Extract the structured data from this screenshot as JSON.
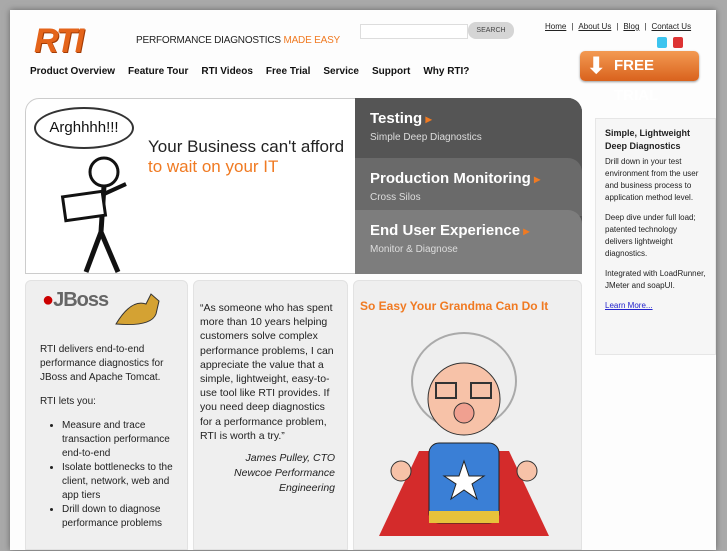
{
  "header": {
    "logo": "RTI",
    "tagline_main": "PERFORMANCE DIAGNOSTICS",
    "tagline_accent": "MADE EASY",
    "search_button": "SEARCH",
    "search_placeholder": "",
    "top_links": [
      "Home",
      "About Us",
      "Blog",
      "Contact Us"
    ],
    "free_trial_button": "FREE TRIAL"
  },
  "nav": [
    "Product Overview",
    "Feature Tour",
    "RTI Videos",
    "Free Trial",
    "Service",
    "Support",
    "Why RTI?"
  ],
  "hero": {
    "bubble": "Arghhhh!!!",
    "headline": "Your Business can't afford",
    "subheadline": "to wait on your IT",
    "tabs": [
      {
        "title": "Testing",
        "subtitle": "Simple Deep Diagnostics"
      },
      {
        "title": "Production Monitoring",
        "subtitle": "Cross Silos"
      },
      {
        "title": "End User Experience",
        "subtitle": "Monitor & Diagnose"
      }
    ]
  },
  "sidebar": {
    "title": "Simple, Lightweight Deep Diagnostics",
    "paragraphs": [
      "Drill down in your test environment from the user and business process to application method level.",
      "Deep dive under full load; patented technology delivers lightweight diagnostics.",
      "Integrated with LoadRunner, JMeter and soapUI."
    ],
    "link": "Learn More..."
  },
  "col1": {
    "logo_jboss": "JBoss",
    "intro": "RTI delivers end-to-end performance diagnostics for JBoss and Apache Tomcat.",
    "lets": "RTI lets you:",
    "bullets": [
      "Measure and trace transaction performance end-to-end",
      "Isolate bottlenecks to the client, network, web and app tiers",
      "Drill down to diagnose performance problems"
    ]
  },
  "col2": {
    "quote": "“As someone who has spent more than 10 years helping customers solve complex performance problems, I can appreciate the value that a simple, lightweight, easy-to-use tool like RTI provides. If you need deep diagnostics for a performance problem, RTI is worth a try.”",
    "author": "James Pulley, CTO",
    "company": "Newcoe Performance Engineering"
  },
  "col3": {
    "title": "So Easy Your Grandma Can Do It"
  }
}
